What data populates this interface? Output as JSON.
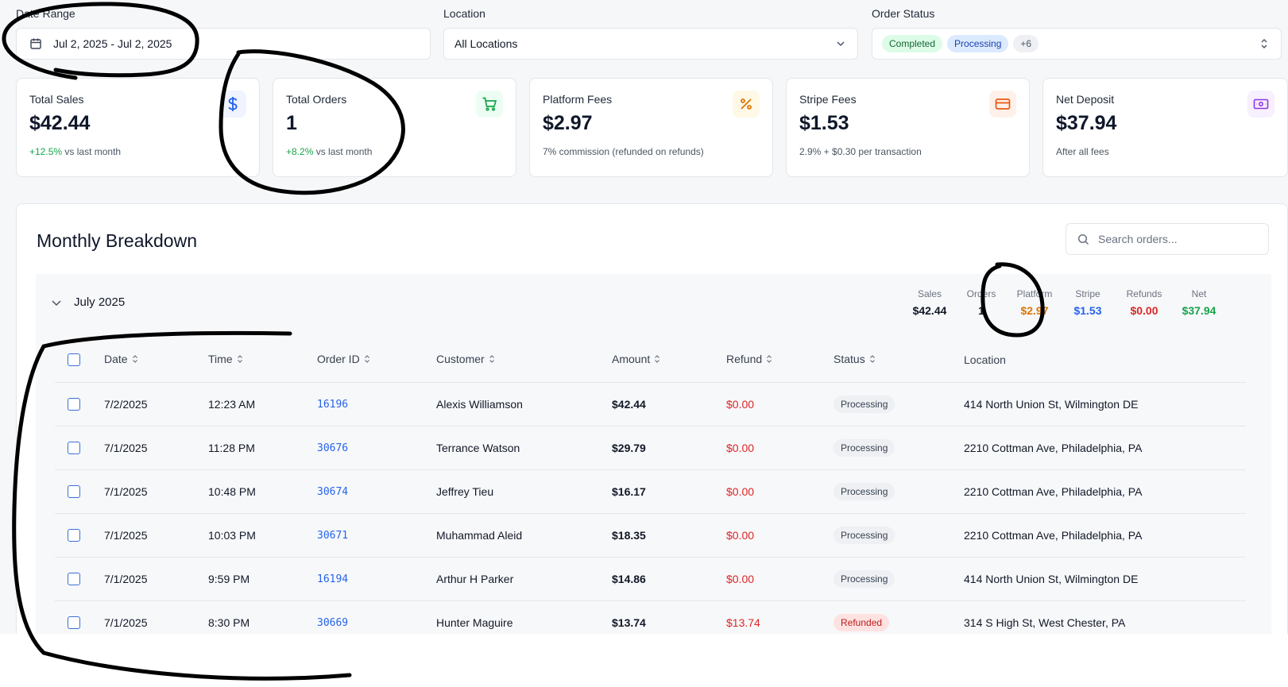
{
  "filters": {
    "date_range": {
      "label": "Date Range",
      "value": "Jul 2, 2025 - Jul 2, 2025"
    },
    "location": {
      "label": "Location",
      "value": "All Locations"
    },
    "order_status": {
      "label": "Order Status",
      "pills": [
        "Completed",
        "Processing",
        "+6"
      ]
    }
  },
  "cards": [
    {
      "title": "Total Sales",
      "value": "$42.44",
      "delta": "+12.5%",
      "sub": "vs last month",
      "icon": "dollar-icon",
      "icon_color": "#2563eb",
      "icon_bg": "#eff4ff"
    },
    {
      "title": "Total Orders",
      "value": "1",
      "delta": "+8.2%",
      "sub": "vs last month",
      "icon": "cart-icon",
      "icon_color": "#16a34a",
      "icon_bg": "#ecfdf3"
    },
    {
      "title": "Platform Fees",
      "value": "$2.97",
      "sub": "7% commission (refunded on refunds)",
      "icon": "percent-icon",
      "icon_color": "#d97706",
      "icon_bg": "#fff8e6"
    },
    {
      "title": "Stripe Fees",
      "value": "$1.53",
      "sub": "2.9% + $0.30 per transaction",
      "icon": "credit-card-icon",
      "icon_color": "#ea580c",
      "icon_bg": "#fff1ea"
    },
    {
      "title": "Net Deposit",
      "value": "$37.94",
      "sub": "After all fees",
      "icon": "banknote-icon",
      "icon_color": "#9333ea",
      "icon_bg": "#f7f0ff"
    }
  ],
  "breakdown": {
    "title": "Monthly Breakdown",
    "search_placeholder": "Search orders...",
    "month": {
      "label": "July 2025",
      "stats": [
        {
          "label": "Sales",
          "value": "$42.44",
          "color": "#111827"
        },
        {
          "label": "Orders",
          "value": "1",
          "color": "#111827"
        },
        {
          "label": "Platform",
          "value": "$2.97",
          "color": "#d97706"
        },
        {
          "label": "Stripe",
          "value": "$1.53",
          "color": "#2563eb"
        },
        {
          "label": "Refunds",
          "value": "$0.00",
          "color": "#dc2626"
        },
        {
          "label": "Net",
          "value": "$37.94",
          "color": "#16a34a"
        }
      ]
    },
    "columns": [
      "Date",
      "Time",
      "Order ID",
      "Customer",
      "Amount",
      "Refund",
      "Status",
      "Location"
    ],
    "rows": [
      {
        "date": "7/2/2025",
        "time": "12:23 AM",
        "order_id": "16196",
        "customer": "Alexis Williamson",
        "amount": "$42.44",
        "refund": "$0.00",
        "status": "Processing",
        "location": "414 North Union St, Wilmington DE"
      },
      {
        "date": "7/1/2025",
        "time": "11:28 PM",
        "order_id": "30676",
        "customer": "Terrance Watson",
        "amount": "$29.79",
        "refund": "$0.00",
        "status": "Processing",
        "location": "2210 Cottman Ave, Philadelphia, PA"
      },
      {
        "date": "7/1/2025",
        "time": "10:48 PM",
        "order_id": "30674",
        "customer": "Jeffrey Tieu",
        "amount": "$16.17",
        "refund": "$0.00",
        "status": "Processing",
        "location": "2210 Cottman Ave, Philadelphia, PA"
      },
      {
        "date": "7/1/2025",
        "time": "10:03 PM",
        "order_id": "30671",
        "customer": "Muhammad Aleid",
        "amount": "$18.35",
        "refund": "$0.00",
        "status": "Processing",
        "location": "2210 Cottman Ave, Philadelphia, PA"
      },
      {
        "date": "7/1/2025",
        "time": "9:59 PM",
        "order_id": "16194",
        "customer": "Arthur H Parker",
        "amount": "$14.86",
        "refund": "$0.00",
        "status": "Processing",
        "location": "414 North Union St, Wilmington DE"
      },
      {
        "date": "7/1/2025",
        "time": "8:30 PM",
        "order_id": "30669",
        "customer": "Hunter Maguire",
        "amount": "$13.74",
        "refund": "$13.74",
        "status": "Refunded",
        "location": "314 S High St, West Chester, PA"
      }
    ]
  }
}
